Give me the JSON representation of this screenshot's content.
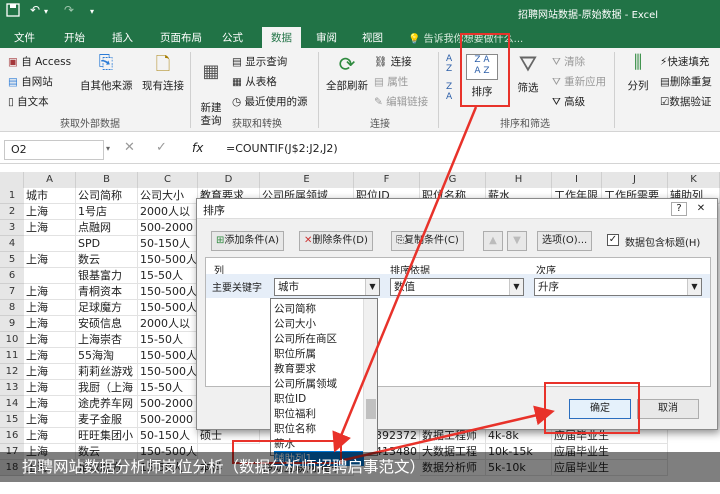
{
  "window": {
    "title": "招聘网站数据-原始数据 - Excel"
  },
  "tabs": [
    "文件",
    "开始",
    "插入",
    "页面布局",
    "公式",
    "数据",
    "审阅",
    "视图"
  ],
  "tell_me": "告诉我你想要做什么...",
  "ribbon": {
    "access": "自 Access",
    "web": "自网站",
    "text": "自文本",
    "other_sources": "自其他来源",
    "existing_conn": "现有连接",
    "new_query": "新建\n查询",
    "show_queries": "显示查询",
    "from_table": "从表格",
    "recent_sources": "最近使用的源",
    "refresh_all": "全部刷新",
    "connections": "连接",
    "properties": "属性",
    "edit_links": "编辑链接",
    "sort_az": "A\nZ",
    "sort": "排序",
    "filter": "筛选",
    "clear": "清除",
    "reapply": "重新应用",
    "advanced": "高级",
    "split_column": "分列",
    "flash_fill": "快速填充",
    "remove_dup": "删除重复",
    "data_validation": "数据验证",
    "grp_external": "获取外部数据",
    "grp_transform": "获取和转换",
    "grp_connections": "连接",
    "grp_sort_filter": "排序和筛选"
  },
  "formula_bar": {
    "name_box": "O2",
    "fx": "fx",
    "formula": "=COUNTIF(J$2:J2,J2)"
  },
  "columns": [
    "A",
    "B",
    "C",
    "D",
    "E",
    "F",
    "G",
    "H",
    "I",
    "J",
    "K"
  ],
  "header_row": [
    "城市",
    "公司简称",
    "公司大小",
    "教育要求",
    "公司所属领域",
    "职位ID",
    "职位名称",
    "薪水",
    "工作年限",
    "工作所需要",
    "辅助列"
  ],
  "rows": [
    {
      "n": "1",
      "a": "城市",
      "b": "公司简称",
      "c": "公司大小"
    },
    {
      "n": "2",
      "a": "上海",
      "b": "1号店",
      "c": "2000人以"
    },
    {
      "n": "3",
      "a": "上海",
      "b": "点融网",
      "c": "500-2000"
    },
    {
      "n": "4",
      "a": "",
      "b": "SPD",
      "c": "50-150人"
    },
    {
      "n": "5",
      "a": "上海",
      "b": "数云",
      "c": "150-500人"
    },
    {
      "n": "6",
      "a": "",
      "b": "银基富力",
      "c": "15-50人"
    },
    {
      "n": "7",
      "a": "上海",
      "b": "青桐资本",
      "c": "150-500人"
    },
    {
      "n": "8",
      "a": "上海",
      "b": "足球魔方",
      "c": "150-500人"
    },
    {
      "n": "9",
      "a": "上海",
      "b": "安硕信息",
      "c": "2000人以"
    },
    {
      "n": "10",
      "a": "上海",
      "b": "上海崇杏",
      "c": "15-50人"
    },
    {
      "n": "11",
      "a": "上海",
      "b": "55海淘",
      "c": "150-500人"
    },
    {
      "n": "12",
      "a": "上海",
      "b": "莉莉丝游戏",
      "c": "150-500人"
    },
    {
      "n": "13",
      "a": "上海",
      "b": "我厨（上海",
      "c": "15-50人"
    },
    {
      "n": "14",
      "a": "上海",
      "b": "途虎养车网",
      "c": "500-2000"
    },
    {
      "n": "15",
      "a": "上海",
      "b": "麦子金服",
      "c": "500-2000"
    },
    {
      "n": "16",
      "a": "上海",
      "b": "旺旺集团小",
      "c": "50-150人"
    },
    {
      "n": "17",
      "a": "上海",
      "b": "数云",
      "c": "150-500人"
    },
    {
      "n": "18",
      "a": "上海",
      "b": "足球魔方",
      "c": "15-50人"
    }
  ],
  "extra_cells": {
    "r16_d": "硕士",
    "r16_f": "392372",
    "r16_g": "数据工程师",
    "r16_h": "4k-8k",
    "r16_j": "应届毕业生",
    "r17_f": "413480",
    "r17_g": "大数据工程",
    "r17_h": "10k-15k",
    "r17_j": "应届毕业生",
    "r18_d": "本科",
    "r18_e": "移动互联网,电子",
    "r18_g": "数据分析师",
    "r18_h": "5k-10k",
    "r18_j": "应届毕业生"
  },
  "dialog": {
    "title": "排序",
    "help": "?",
    "close": "✕",
    "add_level": "添加条件(A)",
    "delete_level": "删除条件(D)",
    "copy_level": "复制条件(C)",
    "options": "选项(O)...",
    "has_headers": "数据包含标题(H)",
    "col_header": "列",
    "sort_on_header": "排序依据",
    "order_header": "次序",
    "primary_key": "主要关键字",
    "column_value": "城市",
    "sort_on_value": "数值",
    "order_value": "升序",
    "ok": "确定",
    "cancel": "取消"
  },
  "dropdown_items": [
    "公司简称",
    "公司大小",
    "公司所在商区",
    "职位所属",
    "教育要求",
    "公司所属领域",
    "职位ID",
    "职位福利",
    "职位名称",
    "薪水",
    "辅助列1"
  ],
  "caption": "招聘网站数据分析师岗位分析（数据分析师招聘启事范文）",
  "colors": {
    "excel_green": "#217346",
    "highlight_red": "#e8322a"
  }
}
